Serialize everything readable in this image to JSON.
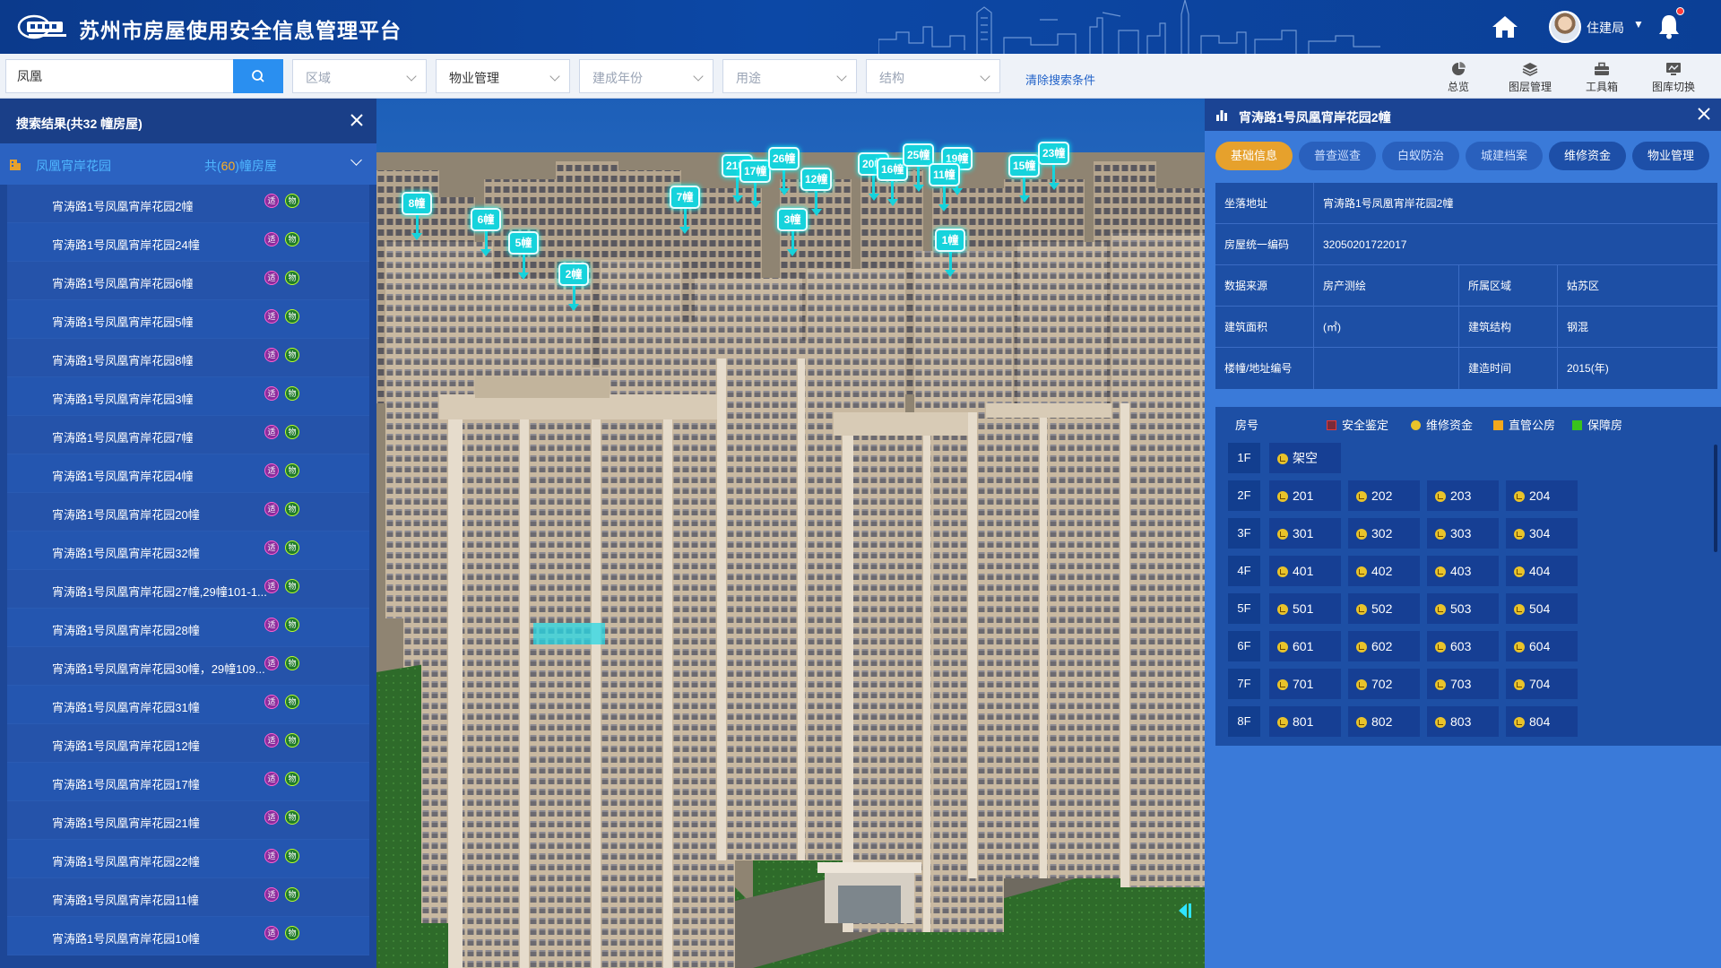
{
  "header": {
    "title": "苏州市房屋使用安全信息管理平台",
    "user_name": "住建局"
  },
  "filters": {
    "search_value": "凤凰",
    "area_placeholder": "区域",
    "property_value": "物业管理",
    "year_placeholder": "建成年份",
    "usage_placeholder": "用途",
    "structure_placeholder": "结构",
    "clear_label": "清除搜索条件"
  },
  "toolbar": [
    "总览",
    "图层管理",
    "工具箱",
    "图库切换"
  ],
  "left_panel": {
    "title": "搜索结果(共32 幢房屋)",
    "group_name": "凤凰宵岸花园",
    "group_count_prefix": "共(",
    "group_count": "60",
    "group_count_suffix": ")幢房屋",
    "badge_a": "适",
    "badge_b": "物",
    "items": [
      "宵涛路1号凤凰宵岸花园2幢",
      "宵涛路1号凤凰宵岸花园24幢",
      "宵涛路1号凤凰宵岸花园6幢",
      "宵涛路1号凤凰宵岸花园5幢",
      "宵涛路1号凤凰宵岸花园8幢",
      "宵涛路1号凤凰宵岸花园3幢",
      "宵涛路1号凤凰宵岸花园7幢",
      "宵涛路1号凤凰宵岸花园4幢",
      "宵涛路1号凤凰宵岸花园20幢",
      "宵涛路1号凤凰宵岸花园32幢",
      "宵涛路1号凤凰宵岸花园27幢,29幢101-1...",
      "宵涛路1号凤凰宵岸花园28幢",
      "宵涛路1号凤凰宵岸花园30幢，29幢109...",
      "宵涛路1号凤凰宵岸花园31幢",
      "宵涛路1号凤凰宵岸花园12幢",
      "宵涛路1号凤凰宵岸花园17幢",
      "宵涛路1号凤凰宵岸花园21幢",
      "宵涛路1号凤凰宵岸花园22幢",
      "宵涛路1号凤凰宵岸花园11幢",
      "宵涛路1号凤凰宵岸花园10幢"
    ]
  },
  "map_markers": [
    "8幢",
    "6幢",
    "5幢",
    "2幢",
    "21幢",
    "17幢",
    "7幢",
    "26幢",
    "3幢",
    "12幢",
    "20幢",
    "16幢",
    "25幢",
    "19幢",
    "11幢",
    "1幢",
    "15幢",
    "23幢"
  ],
  "right_panel": {
    "title": "宵涛路1号凤凰宵岸花园2幢",
    "tabs": [
      "基础信息",
      "普查巡查",
      "白蚁防治",
      "城建档案",
      "维修资金",
      "物业管理"
    ],
    "info": {
      "address_label": "坐落地址",
      "address_value": "宵涛路1号凤凰宵岸花园2幢",
      "code_label": "房屋统一编码",
      "code_value": "32050201722017",
      "source_label": "数据来源",
      "source_value": "房产测绘",
      "region_label": "所属区域",
      "region_value": "姑苏区",
      "area_label": "建筑面积",
      "area_value": "(㎡)",
      "structure_label": "建筑结构",
      "structure_value": "钢混",
      "number_label": "楼幢/地址编号",
      "number_value": "",
      "built_label": "建造时间",
      "built_value": "2015(年)"
    },
    "legend": {
      "room_label": "房号",
      "items": [
        {
          "label": "安全鉴定",
          "color": "#e23a3a"
        },
        {
          "label": "维修资金",
          "color": "#e9c32a"
        },
        {
          "label": "直管公房",
          "color": "#f2a81c"
        },
        {
          "label": "保障房",
          "color": "#39c21c"
        }
      ]
    },
    "floors": [
      {
        "floor": "1F",
        "rooms": [
          "架空"
        ]
      },
      {
        "floor": "2F",
        "rooms": [
          "201",
          "202",
          "203",
          "204"
        ]
      },
      {
        "floor": "3F",
        "rooms": [
          "301",
          "302",
          "303",
          "304"
        ]
      },
      {
        "floor": "4F",
        "rooms": [
          "401",
          "402",
          "403",
          "404"
        ]
      },
      {
        "floor": "5F",
        "rooms": [
          "501",
          "502",
          "503",
          "504"
        ]
      },
      {
        "floor": "6F",
        "rooms": [
          "601",
          "602",
          "603",
          "604"
        ]
      },
      {
        "floor": "7F",
        "rooms": [
          "701",
          "702",
          "703",
          "704"
        ]
      },
      {
        "floor": "8F",
        "rooms": [
          "801",
          "802",
          "803",
          "804"
        ]
      }
    ]
  }
}
